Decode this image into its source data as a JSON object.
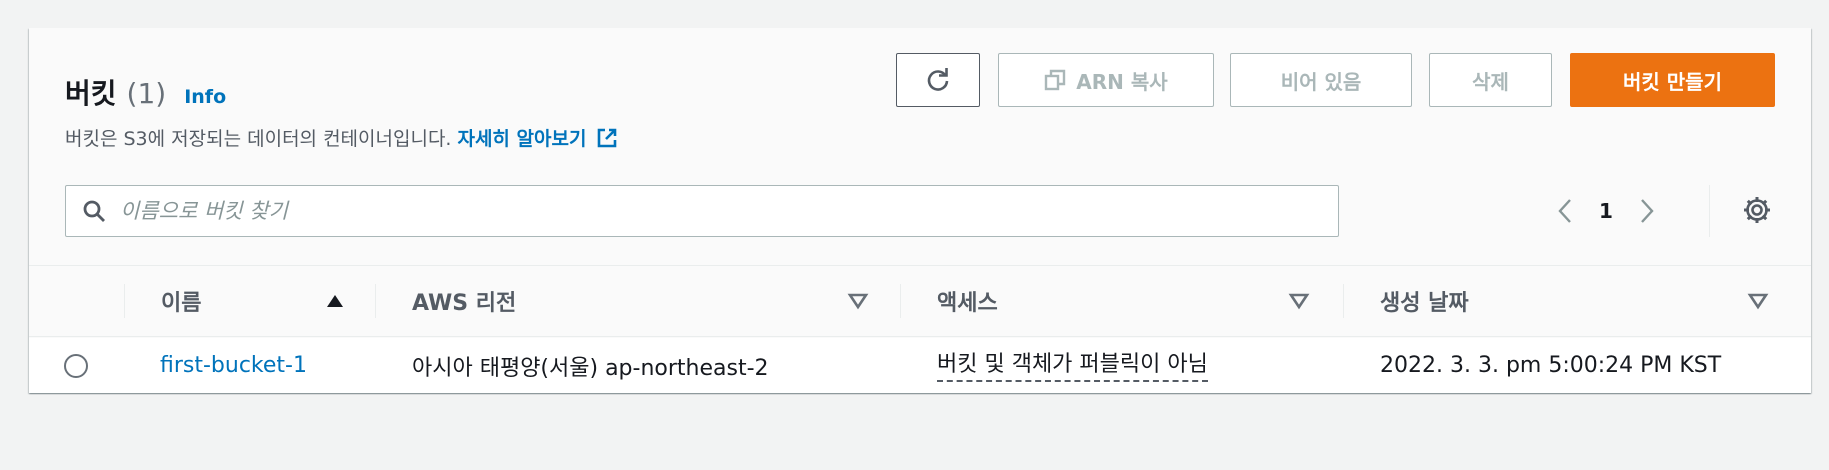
{
  "header": {
    "title": "버킷",
    "count": "(1)",
    "info": "Info",
    "description": "버킷은 S3에 저장되는 데이터의 컨테이너입니다.",
    "learn_more": "자세히 알아보기"
  },
  "toolbar": {
    "copy_arn": "ARN 복사",
    "empty": "비어 있음",
    "delete": "삭제",
    "create": "버킷 만들기"
  },
  "search": {
    "placeholder": "이름으로 버킷 찾기",
    "value": ""
  },
  "pagination": {
    "current_page": "1"
  },
  "table": {
    "columns": [
      "이름",
      "AWS 리전",
      "액세스",
      "생성 날짜"
    ],
    "rows": [
      {
        "name": "first-bucket-1",
        "region": "아시아 태평양(서울) ap-northeast-2",
        "access": "버킷 및 객체가 퍼블릭이 아님",
        "created": "2022. 3. 3. pm 5:00:24 PM KST"
      }
    ]
  },
  "colors": {
    "accent_orange": "#ec7211",
    "link_blue": "#0073bb",
    "panel_bg": "#fafafa",
    "page_bg": "#f2f3f3"
  },
  "icons": [
    "refresh-icon",
    "copy-icon",
    "external-link-icon",
    "search-icon",
    "chevron-left-icon",
    "chevron-right-icon",
    "gear-icon",
    "sort-ascending-icon",
    "sort-descending-icon"
  ]
}
